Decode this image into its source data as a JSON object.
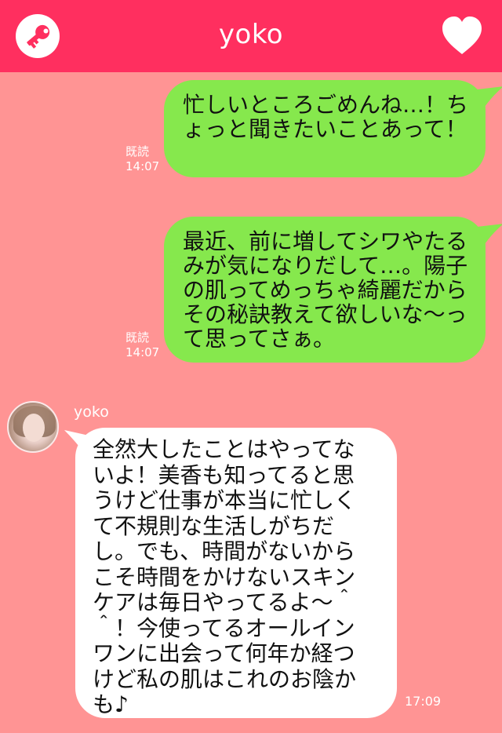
{
  "header": {
    "title": "yoko",
    "key_icon": "key-icon",
    "heart_icon": "heart-icon",
    "bar_color": "#ff2f5f"
  },
  "messages": [
    {
      "direction": "sent",
      "text": "忙しいところごめんね…！ちょっと聞きたいことあって！",
      "read_label": "既読",
      "time": "14:07"
    },
    {
      "direction": "sent",
      "text": "最近、前に増してシワやたるみが気になりだして…。陽子の肌ってめっちゃ綺麗だからその秘訣教えて欲しいな〜って思ってさぁ。",
      "read_label": "既読",
      "time": "14:07"
    },
    {
      "direction": "received",
      "sender": "yoko",
      "text": "全然大したことはやってないよ！美香も知ってると思うけど仕事が本当に忙しくて不規則な生活しがちだし。でも、時間がないからこそ時間をかけないスキンケアは毎日やってるよ〜＾＾！今使ってるオールインワンに出会って何年か経つけど私の肌はこれのお陰かも♪",
      "time": "17:09"
    }
  ],
  "colors": {
    "background": "#ff9494",
    "sent_bubble": "#86e84d",
    "received_bubble": "#ffffff"
  }
}
